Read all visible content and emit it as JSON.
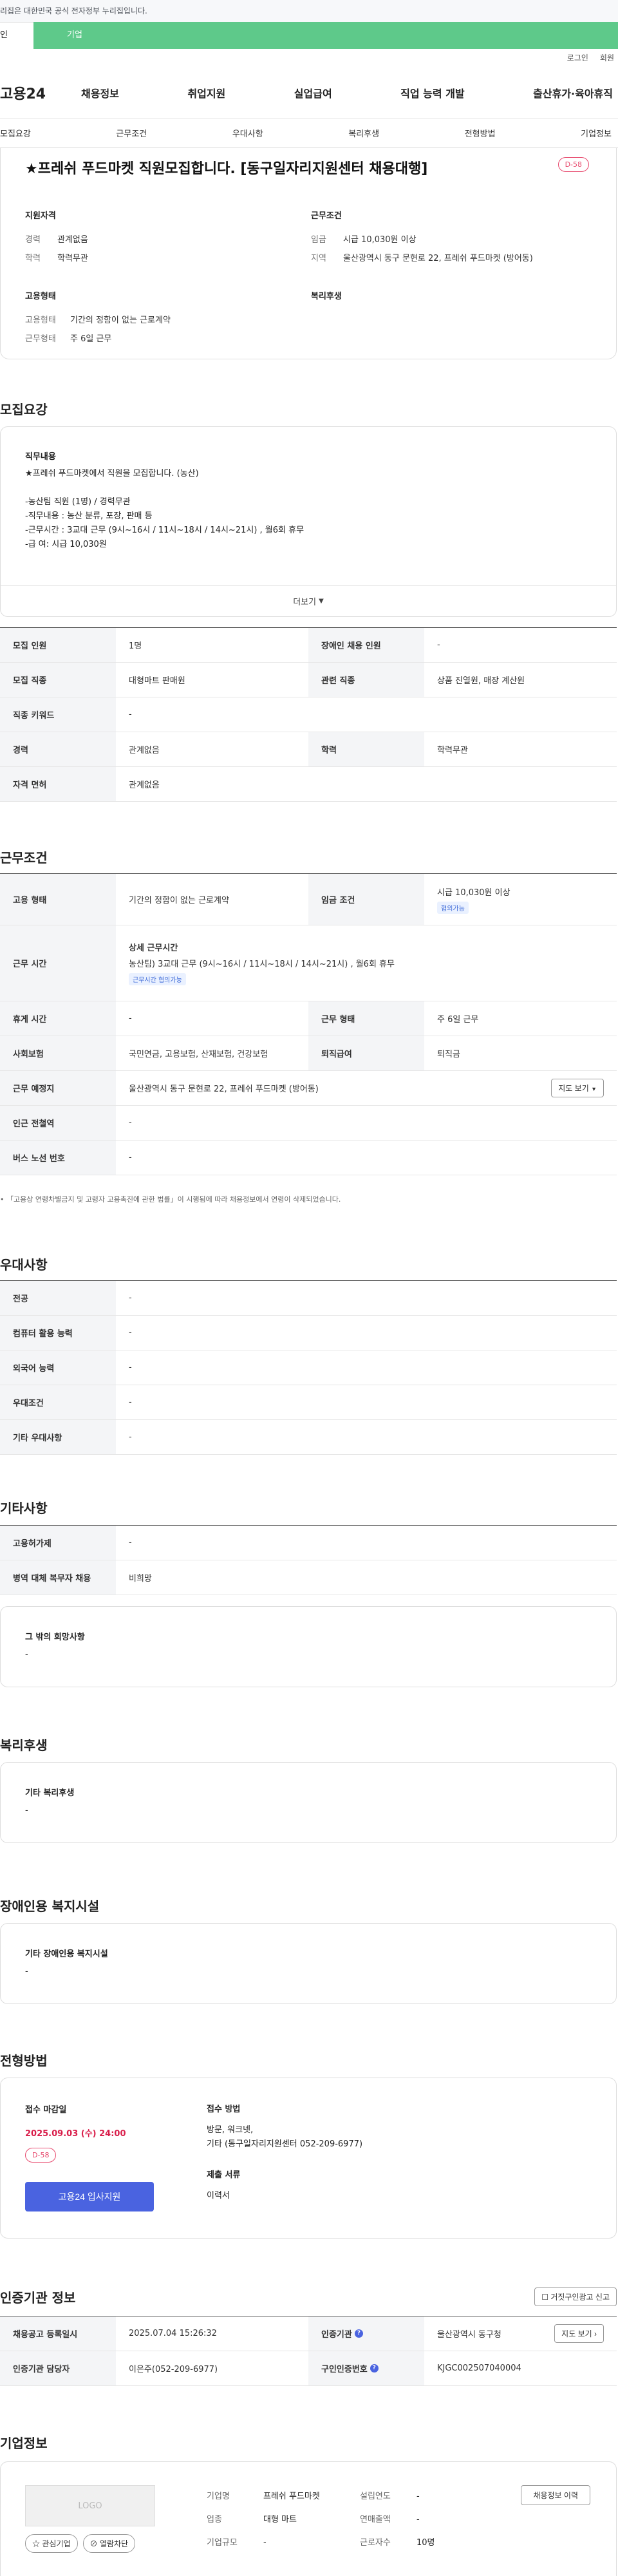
{
  "topbar": {
    "notice": "리집은 대한민국 공식 전자정부 누리집입니다."
  },
  "gnb": {
    "tab_personal": "인",
    "tab_company": "기업"
  },
  "util": {
    "login": "로그인",
    "signup": "회원"
  },
  "header": {
    "logo": "고용24",
    "menu": [
      "채용정보",
      "취업지원",
      "실업급여",
      "직업 능력 개발",
      "출산휴가·육아휴직"
    ]
  },
  "anchors": [
    "모집요강",
    "근무조건",
    "우대사항",
    "복리후생",
    "전형방법",
    "기업정보"
  ],
  "summary": {
    "title": "★프레쉬 푸드마켓 직원모집합니다. [동구일자리지원센터 채용대행]",
    "dday": "D-58",
    "qual_title": "지원자격",
    "qual": [
      {
        "k": "경력",
        "v": "관계없음"
      },
      {
        "k": "학력",
        "v": "학력무관"
      }
    ],
    "cond_title": "근무조건",
    "cond": [
      {
        "k": "임금",
        "v": "시급 10,030원 이상"
      },
      {
        "k": "지역",
        "v": "울산광역시 동구 문현로 22, 프레쉬 푸드마켓 (방어동)"
      }
    ],
    "emp_title": "고용형태",
    "emp": [
      {
        "k": "고용형태",
        "v": "기간의 정함이 없는 근로계약"
      },
      {
        "k": "근무형태",
        "v": "주 6일 근무"
      }
    ],
    "welfare_title": "복리후생"
  },
  "recruit": {
    "title": "모집요강",
    "duty_title": "직무내용",
    "duty_lines": [
      "★프레쉬 푸드마켓에서 직원을 모집합니다. (농산)",
      "",
      "-농산팀 직원 (1명) / 경력무관",
      "-직무내용 : 농산 분류, 포장, 판매 등",
      "-근무시간 : 3교대 근무 (9시~16시 / 11시~18시 / 14시~21시) , 월6회 휴무",
      "-급 여: 시급 10,030원"
    ],
    "more": "더보기",
    "rows": [
      {
        "k1": "모집 인원",
        "v1": "1명",
        "k2": "장애인 채용 인원",
        "v2": "-"
      },
      {
        "k1": "모집 직종",
        "v1": "대형마트 판매원",
        "k2": "관련 직종",
        "v2": "상품 진열원, 매장 계산원"
      },
      {
        "k1": "직종 키워드",
        "v1": "-"
      },
      {
        "k1": "경력",
        "v1": "관계없음",
        "k2": "학력",
        "v2": "학력무관"
      },
      {
        "k1": "자격 면허",
        "v1": "관계없음"
      }
    ]
  },
  "work": {
    "title": "근무조건",
    "emp_type_k": "고용 형태",
    "emp_type_v": "기간의 정함이 없는 근로계약",
    "wage_k": "임금 조건",
    "wage_v": "시급 10,030원 이상",
    "wage_chip": "협의가능",
    "hours_k": "근무 시간",
    "hours_head": "상세 근무시간",
    "hours_v": "농산팀) 3교대 근무 (9시~16시 / 11시~18시 / 14시~21시) , 월6회 휴무",
    "hours_chip": "근무시간 협의가능",
    "rest_k": "휴게 시간",
    "rest_v": "-",
    "shape_k": "근무 형태",
    "shape_v": "주 6일 근무",
    "ins_k": "사회보험",
    "ins_v": "국민연금, 고용보험, 산재보험, 건강보험",
    "sev_k": "퇴직급여",
    "sev_v": "퇴직금",
    "place_k": "근무 예정지",
    "place_v": "울산광역시 동구 문현로 22, 프레쉬 푸드마켓 (방어동)",
    "map_btn": "지도 보기",
    "subway_k": "인근 전철역",
    "subway_v": "-",
    "bus_k": "버스 노선 번호",
    "bus_v": "-",
    "note": "「고용상 연령차별금지 및 고령자 고용촉진에 관한 법률」이 시행됨에 따라 채용정보에서 연령이 삭제되었습니다."
  },
  "pref": {
    "title": "우대사항",
    "rows": [
      {
        "k": "전공",
        "v": "-"
      },
      {
        "k": "컴퓨터 활용 능력",
        "v": "-"
      },
      {
        "k": "외국어 능력",
        "v": "-"
      },
      {
        "k": "우대조건",
        "v": "-"
      },
      {
        "k": "기타 우대사항",
        "v": "-"
      }
    ]
  },
  "etc": {
    "title": "기타사항",
    "rows": [
      {
        "k": "고용허가제",
        "v": "-"
      },
      {
        "k": "병역 대체 복무자 채용",
        "v": "비희망"
      }
    ],
    "hope_title": "그 밖의 희망사항",
    "hope_v": "-"
  },
  "welfare": {
    "title": "복리후생",
    "box_title": "기타 복리후생",
    "box_v": "-"
  },
  "disab": {
    "title": "장애인용 복지시설",
    "box_title": "기타 장애인용 복지시설",
    "box_v": "-"
  },
  "process": {
    "title": "전형방법",
    "deadline_k": "접수 마감일",
    "deadline_v": "2025.09.03 (수) 24:00",
    "dday": "D-58",
    "apply_btn": "고용24 입사지원",
    "method_k": "접수 방법",
    "method_v1": "방문, 워크넷,",
    "method_v2": "기타 (동구일자리지원센터 052-209-6977)",
    "docs_k": "제출 서류",
    "docs_v": "이력서"
  },
  "cert": {
    "title": "인증기관 정보",
    "report_btn": "거짓구인광고 신고",
    "reg_k": "채용공고 등록일시",
    "reg_v": "2025.07.04 15:26:32",
    "org_k": "인증기관",
    "org_v": "울산광역시 동구청",
    "map_btn": "지도 보기",
    "mgr_k": "인증기관 담당자",
    "mgr_v": "이은주(052-209-6977)",
    "num_k": "구인인증번호",
    "num_v": "KJGC002507040004"
  },
  "company": {
    "title": "기업정보",
    "logo": "LOGO",
    "fav_btn": "관심기업",
    "block_btn": "열람차단",
    "hist_btn": "채용정보 이력",
    "name_k": "기업명",
    "name_v": "프레쉬 푸드마켓",
    "year_k": "설립연도",
    "year_v": "-",
    "ind_k": "업종",
    "ind_v": "대형 마트",
    "sales_k": "연매출액",
    "sales_v": "-",
    "size_k": "기업규모",
    "size_v": "-",
    "emp_k": "근로자수",
    "emp_v": "10명"
  }
}
